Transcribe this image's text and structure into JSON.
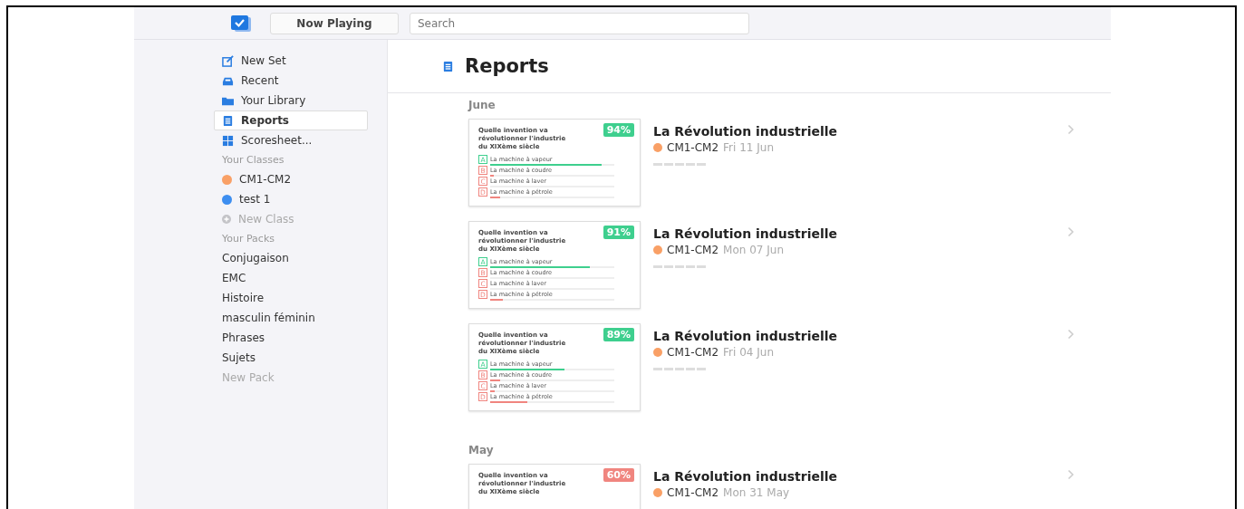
{
  "topbar": {
    "now_playing": "Now Playing",
    "search_placeholder": "Search"
  },
  "sidebar": {
    "nav": [
      {
        "kind": "new_set",
        "label": "New Set",
        "selected": false
      },
      {
        "kind": "recent",
        "label": "Recent",
        "selected": false
      },
      {
        "kind": "library",
        "label": "Your Library",
        "selected": false
      },
      {
        "kind": "reports",
        "label": "Reports",
        "selected": true
      },
      {
        "kind": "scoresheet",
        "label": "Scoresheet...",
        "selected": false
      }
    ],
    "classes_heading": "Your Classes",
    "classes": [
      {
        "label": "CM1-CM2",
        "color": "#f9a066"
      },
      {
        "label": "test 1",
        "color": "#3d8ef0"
      }
    ],
    "new_class": "New Class",
    "packs_heading": "Your Packs",
    "packs": [
      "Conjugaison",
      "EMC",
      "Histoire",
      "masculin féminin",
      "Phrases",
      "Sujets"
    ],
    "new_pack": "New Pack"
  },
  "page_title": "Reports",
  "groups": [
    {
      "month": "June",
      "reports": [
        {
          "score": "94%",
          "color": "#3ecf8e",
          "question": "Quelle invention va révolutionner l'industrie du XIXème siècle",
          "answers": [
            {
              "letter": "A",
              "text": "La machine à vapeur",
              "correct": true,
              "level": 0.9
            },
            {
              "letter": "B",
              "text": "La machine à coudre",
              "correct": false,
              "level": 0.03
            },
            {
              "letter": "C",
              "text": "La machine à laver",
              "correct": false,
              "level": 0.0
            },
            {
              "letter": "D",
              "text": "La machine à pétrole",
              "correct": false,
              "level": 0.08
            }
          ],
          "title": "La Révolution industrielle",
          "class": {
            "name": "CM1-CM2",
            "color": "#f9a066"
          },
          "date": "Fri 11 Jun"
        },
        {
          "score": "91%",
          "color": "#3ecf8e",
          "question": "Quelle invention va révolutionner l'industrie du XIXème siècle",
          "answers": [
            {
              "letter": "A",
              "text": "La machine à vapeur",
              "correct": true,
              "level": 0.8
            },
            {
              "letter": "B",
              "text": "La machine à coudre",
              "correct": false,
              "level": 0.0
            },
            {
              "letter": "C",
              "text": "La machine à laver",
              "correct": false,
              "level": 0.0
            },
            {
              "letter": "D",
              "text": "La machine à pétrole",
              "correct": false,
              "level": 0.1
            }
          ],
          "title": "La Révolution industrielle",
          "class": {
            "name": "CM1-CM2",
            "color": "#f9a066"
          },
          "date": "Mon 07 Jun"
        },
        {
          "score": "89%",
          "color": "#3ecf8e",
          "question": "Quelle invention va révolutionner l'industrie du XIXème siècle",
          "answers": [
            {
              "letter": "A",
              "text": "La machine à vapeur",
              "correct": true,
              "level": 0.6
            },
            {
              "letter": "B",
              "text": "La machine à coudre",
              "correct": false,
              "level": 0.08
            },
            {
              "letter": "C",
              "text": "La machine à laver",
              "correct": false,
              "level": 0.04
            },
            {
              "letter": "D",
              "text": "La machine à pétrole",
              "correct": false,
              "level": 0.3
            }
          ],
          "title": "La Révolution industrielle",
          "class": {
            "name": "CM1-CM2",
            "color": "#f9a066"
          },
          "date": "Fri 04 Jun"
        }
      ]
    },
    {
      "month": "May",
      "reports": [
        {
          "score": "60%",
          "color": "#f0857f",
          "question": "Quelle invention va révolutionner l'industrie du XIXème siècle",
          "title": "La Révolution industrielle",
          "class": {
            "name": "CM1-CM2",
            "color": "#f9a066"
          },
          "date": "Mon 31 May"
        }
      ]
    }
  ]
}
